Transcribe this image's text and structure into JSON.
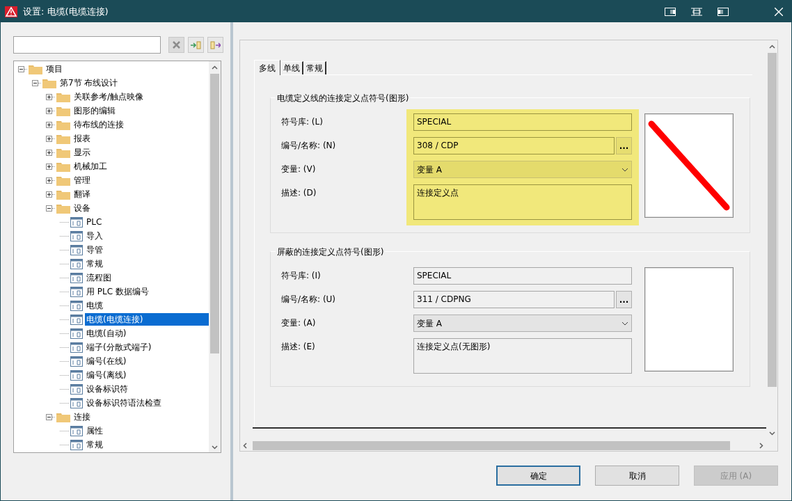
{
  "window": {
    "title": "设置: 电缆(电缆连接)"
  },
  "tree": [
    {
      "label": "项目",
      "kind": "folder",
      "expanded": true,
      "selected": false,
      "children": [
        {
          "label": "第7节 布线设计",
          "kind": "folder",
          "expanded": true,
          "selected": false,
          "children": [
            {
              "label": "关联参考/触点映像",
              "kind": "folder",
              "expanded": false,
              "selected": false
            },
            {
              "label": "图形的编辑",
              "kind": "folder",
              "expanded": false,
              "selected": false
            },
            {
              "label": "待布线的连接",
              "kind": "folder",
              "expanded": false,
              "selected": false
            },
            {
              "label": "报表",
              "kind": "folder",
              "expanded": false,
              "selected": false
            },
            {
              "label": "显示",
              "kind": "folder",
              "expanded": false,
              "selected": false
            },
            {
              "label": "机械加工",
              "kind": "folder",
              "expanded": false,
              "selected": false
            },
            {
              "label": "管理",
              "kind": "folder",
              "expanded": false,
              "selected": false
            },
            {
              "label": "翻译",
              "kind": "folder",
              "expanded": false,
              "selected": false
            },
            {
              "label": "设备",
              "kind": "folder",
              "expanded": true,
              "selected": false,
              "children": [
                {
                  "label": "PLC",
                  "kind": "page",
                  "selected": false
                },
                {
                  "label": "导入",
                  "kind": "page",
                  "selected": false
                },
                {
                  "label": "导管",
                  "kind": "page",
                  "selected": false
                },
                {
                  "label": "常规",
                  "kind": "page",
                  "selected": false
                },
                {
                  "label": "流程图",
                  "kind": "page",
                  "selected": false
                },
                {
                  "label": "用 PLC 数据编号",
                  "kind": "page",
                  "selected": false
                },
                {
                  "label": "电缆",
                  "kind": "page",
                  "selected": false
                },
                {
                  "label": "电缆(电缆连接)",
                  "kind": "page",
                  "selected": true
                },
                {
                  "label": "电缆(自动)",
                  "kind": "page",
                  "selected": false
                },
                {
                  "label": "端子(分散式端子)",
                  "kind": "page",
                  "selected": false
                },
                {
                  "label": "编号(在线)",
                  "kind": "page",
                  "selected": false
                },
                {
                  "label": "编号(离线)",
                  "kind": "page",
                  "selected": false
                },
                {
                  "label": "设备标识符",
                  "kind": "page",
                  "selected": false
                },
                {
                  "label": "设备标识符语法检查",
                  "kind": "page",
                  "selected": false
                }
              ]
            },
            {
              "label": "连接",
              "kind": "folder",
              "expanded": true,
              "selected": false,
              "children": [
                {
                  "label": "属性",
                  "kind": "page",
                  "selected": false
                },
                {
                  "label": "常规",
                  "kind": "page",
                  "selected": false
                }
              ]
            }
          ]
        }
      ]
    }
  ],
  "tabs": [
    {
      "label": "多线",
      "selected": true
    },
    {
      "label": "单线",
      "selected": false
    },
    {
      "label": "常规",
      "selected": false
    }
  ],
  "groups": [
    {
      "title": "电缆定义线的连接定义点符号(图形)",
      "highlighted": true,
      "symbol": true,
      "fields": [
        {
          "kind": "text",
          "label": "符号库: (L)",
          "value": "SPECIAL"
        },
        {
          "kind": "browse",
          "label": "编号/名称: (N)",
          "value": "308 / CDP",
          "button": "..."
        },
        {
          "kind": "select",
          "label": "变量: (V)",
          "value": "变量 A"
        },
        {
          "kind": "textarea",
          "label": "描述: (D)",
          "value": "连接定义点"
        }
      ]
    },
    {
      "title": "屏蔽的连接定义点符号(图形)",
      "highlighted": false,
      "symbol": false,
      "fields": [
        {
          "kind": "text",
          "label": "符号库: (I)",
          "value": "SPECIAL"
        },
        {
          "kind": "browse",
          "label": "编号/名称: (U)",
          "value": "311 / CDPNG",
          "button": "..."
        },
        {
          "kind": "select",
          "label": "变量: (A)",
          "value": "变量 A"
        },
        {
          "kind": "textarea",
          "label": "描述: (E)",
          "value": "连接定义点(无图形)"
        }
      ]
    }
  ],
  "buttons": [
    {
      "label": "确定",
      "default": true,
      "disabled": false
    },
    {
      "label": "取消",
      "default": false,
      "disabled": false
    },
    {
      "label": "应用 (A)",
      "default": false,
      "disabled": true
    }
  ]
}
